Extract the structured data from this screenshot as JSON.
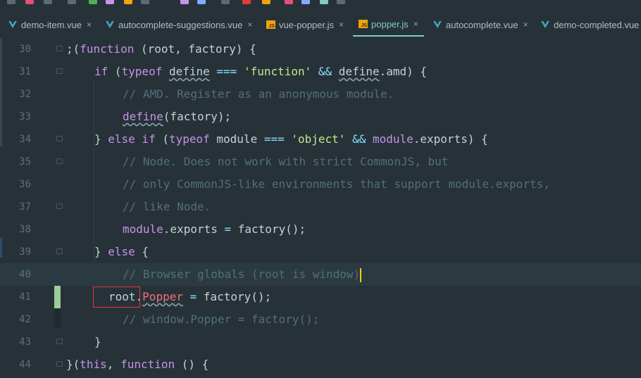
{
  "toolbar": {
    "icons": [
      "undo-icon",
      "redo-icon",
      "run-icon",
      "debug-icon",
      "build-icon",
      "settings-icon",
      "search-icon"
    ]
  },
  "tabs": [
    {
      "label": "demo-item.vue",
      "type": "vue",
      "active": false
    },
    {
      "label": "autocomplete-suggestions.vue",
      "type": "vue",
      "active": false
    },
    {
      "label": "vue-popper.js",
      "type": "js",
      "active": false
    },
    {
      "label": "popper.js",
      "type": "js",
      "active": true
    },
    {
      "label": "autocomplete.vue",
      "type": "vue",
      "active": false
    },
    {
      "label": "demo-completed.vue",
      "type": "vue",
      "active": false
    }
  ],
  "close_glyph": "×",
  "js_badge": "JS",
  "lines": [
    {
      "num": "30"
    },
    {
      "num": "31"
    },
    {
      "num": "32"
    },
    {
      "num": "33"
    },
    {
      "num": "34"
    },
    {
      "num": "35"
    },
    {
      "num": "36"
    },
    {
      "num": "37"
    },
    {
      "num": "38"
    },
    {
      "num": "39"
    },
    {
      "num": "40"
    },
    {
      "num": "41"
    },
    {
      "num": "42"
    },
    {
      "num": "43"
    },
    {
      "num": "44"
    }
  ],
  "code": {
    "l30": {
      "a": ";(",
      "b": "function",
      "c": " (root, factory) {"
    },
    "l31": {
      "a": "if",
      "b": " (",
      "c": "typeof",
      "d": " ",
      "e": "define",
      "f": " === ",
      "g": "'function'",
      "h": " && ",
      "i": "define",
      "j": ".amd) {"
    },
    "l32": {
      "a": "// AMD. Register as an anonymous module."
    },
    "l33": {
      "a": "define",
      "b": "(factory);"
    },
    "l34": {
      "a": "} ",
      "b": "else if",
      "c": " (",
      "d": "typeof",
      "e": " module ",
      "f": "===",
      "g": " ",
      "h": "'object'",
      "i": " && ",
      "j": "module",
      ".k": "",
      "k": ".exports) {"
    },
    "l35": {
      "a": "// Node. Does not work with strict CommonJS, but"
    },
    "l36": {
      "a": "// only CommonJS-like environments that support module.exports,"
    },
    "l37": {
      "a": "// like Node."
    },
    "l38": {
      "a": "module",
      "b": ".exports ",
      "c": "=",
      "d": " factory();"
    },
    "l39": {
      "a": "} ",
      "b": "else",
      "c": " {"
    },
    "l40": {
      "a": "// Browser globals (root is window)"
    },
    "l41": {
      "a": "root.",
      "b": "Popper",
      "c": " ",
      "d": "=",
      "e": " factory();"
    },
    "l42": {
      "a": "// window.Popper = factory();"
    },
    "l43": {
      "a": "}"
    },
    "l44": {
      "a": "}(",
      "b": "this",
      ",c": "",
      "c": ", ",
      "d": "function",
      "e": " () {"
    }
  },
  "colors": {
    "background": "#263238",
    "keyword": "#c792ea",
    "string": "#c3e88d",
    "comment": "#546e7a",
    "accent": "#80cbc4",
    "highlight_box": "#e53935",
    "caret": "#ffcc00"
  }
}
